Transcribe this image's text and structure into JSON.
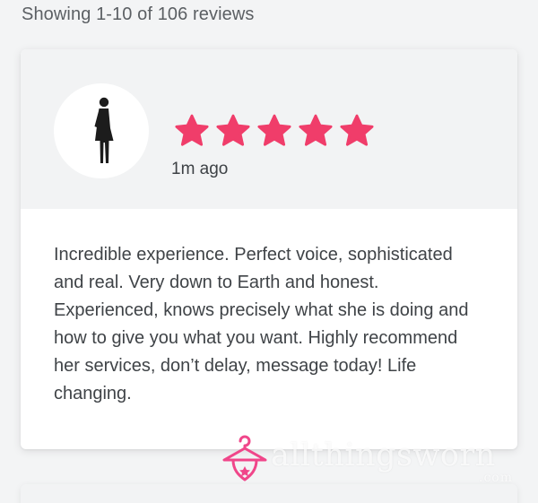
{
  "results": {
    "count_text": "Showing 1-10 of 106 reviews"
  },
  "review": {
    "rating": 5,
    "max_rating": 5,
    "time_ago": "1m ago",
    "text": "Incredible experience. Perfect voice, sophisticated and real. Very down to Earth and honest. Experienced, knows precisely what she is doing and how to give you what you want. Highly recommend her services, don’t delay, message today! Life changing.",
    "avatar_icon": "woman-figure-icon",
    "star_icon": "star-icon",
    "star_color": "#f03d6a"
  },
  "watermark": {
    "text": "allthingsworn",
    "suffix": ".com",
    "icon": "hanger-icon",
    "color": "#f0468a"
  }
}
